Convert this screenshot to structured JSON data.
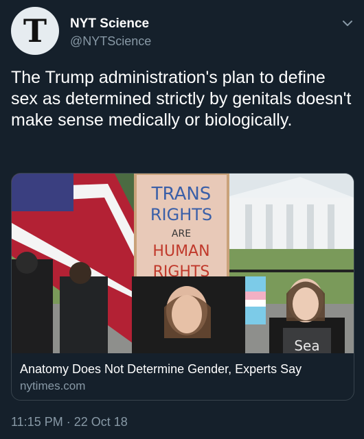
{
  "header": {
    "avatar_glyph": "T",
    "display_name": "NYT Science",
    "handle": "@NYTScience"
  },
  "tweet": {
    "text": "The Trump administration's plan to define sex as determined strictly by genitals doesn't make sense medically or biologically.",
    "timestamp": "11:15 PM · 22 Oct 18"
  },
  "card": {
    "sign_line1": "TRANS",
    "sign_line2": "RIGHTS",
    "sign_line3": "ARE",
    "sign_line4": "HUMAN",
    "sign_line5": "RIGHTS",
    "shirt_text": "Sea",
    "title": "Anatomy Does Not Determine Gender, Experts Say",
    "domain": "nytimes.com"
  },
  "colors": {
    "background": "#15202b",
    "secondary_text": "#8899a6",
    "border": "#38444d"
  },
  "icons": {
    "avatar": "nyt-logo-icon",
    "menu": "chevron-down-icon"
  }
}
